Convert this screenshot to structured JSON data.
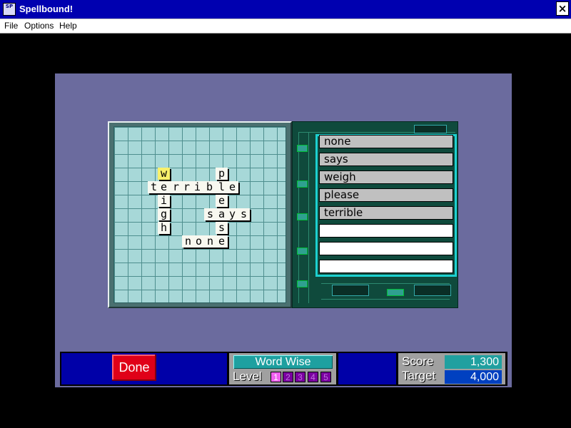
{
  "window": {
    "title": "Spellbound!",
    "close_symbol": "×",
    "icon": "spellbound-app-icon",
    "icon_text": "SP"
  },
  "menu": {
    "items": [
      "File",
      "Options",
      "Help"
    ]
  },
  "board": {
    "tiles": [
      {
        "ch": "w",
        "hl": true
      },
      {
        "ch": "p"
      },
      {
        "ch": "t"
      },
      {
        "ch": "e"
      },
      {
        "ch": "r"
      },
      {
        "ch": "r"
      },
      {
        "ch": "i"
      },
      {
        "ch": "b"
      },
      {
        "ch": "l"
      },
      {
        "ch": "e"
      },
      {
        "ch": "i"
      },
      {
        "ch": "e"
      },
      {
        "ch": "g"
      },
      {
        "ch": "s"
      },
      {
        "ch": "a"
      },
      {
        "ch": "y"
      },
      {
        "ch": "s"
      },
      {
        "ch": "h"
      },
      {
        "ch": "s"
      },
      {
        "ch": "n"
      },
      {
        "ch": "o"
      },
      {
        "ch": "n"
      },
      {
        "ch": "e"
      }
    ]
  },
  "word_list": {
    "words": [
      "none",
      "says",
      "weigh",
      "please",
      "terrible"
    ],
    "empty_slots": 3
  },
  "bottom": {
    "done_label": "Done",
    "game_name": "Word Wise",
    "level_label": "Level",
    "levels": [
      "1",
      "2",
      "3",
      "4",
      "5"
    ],
    "active_level": "1",
    "score_label": "Score",
    "score_value": "1,300",
    "target_label": "Target",
    "target_value": "4,000",
    "colors": {
      "score_bg": "#20a0a0",
      "target_bg": "#0040c0",
      "done_bg": "#e00018"
    }
  }
}
